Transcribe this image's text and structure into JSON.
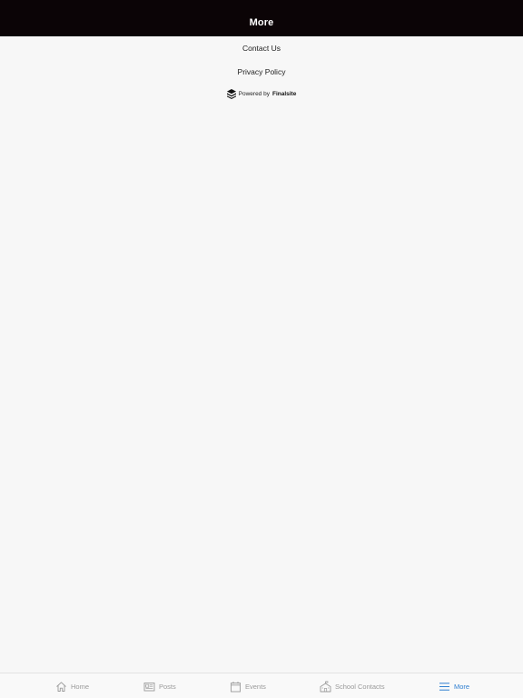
{
  "header": {
    "title": "More"
  },
  "menu": {
    "items": [
      {
        "label": "Contact Us"
      },
      {
        "label": "Privacy Policy"
      }
    ]
  },
  "powered": {
    "prefix": "Powered by",
    "brand": "Finalsite",
    "icon": "finalsite-logo-icon"
  },
  "tabbar": {
    "tabs": [
      {
        "label": "Home",
        "icon": "home-icon",
        "active": false
      },
      {
        "label": "Posts",
        "icon": "posts-icon",
        "active": false
      },
      {
        "label": "Events",
        "icon": "calendar-icon",
        "active": false
      },
      {
        "label": "School Contacts",
        "icon": "school-contacts-icon",
        "active": false
      },
      {
        "label": "More",
        "icon": "menu-icon",
        "active": true
      }
    ],
    "active_color": "#2f7fd1",
    "inactive_color": "#9a9a9a"
  },
  "colors": {
    "header_bg": "#0b0406",
    "page_bg": "#f7f7f7"
  }
}
